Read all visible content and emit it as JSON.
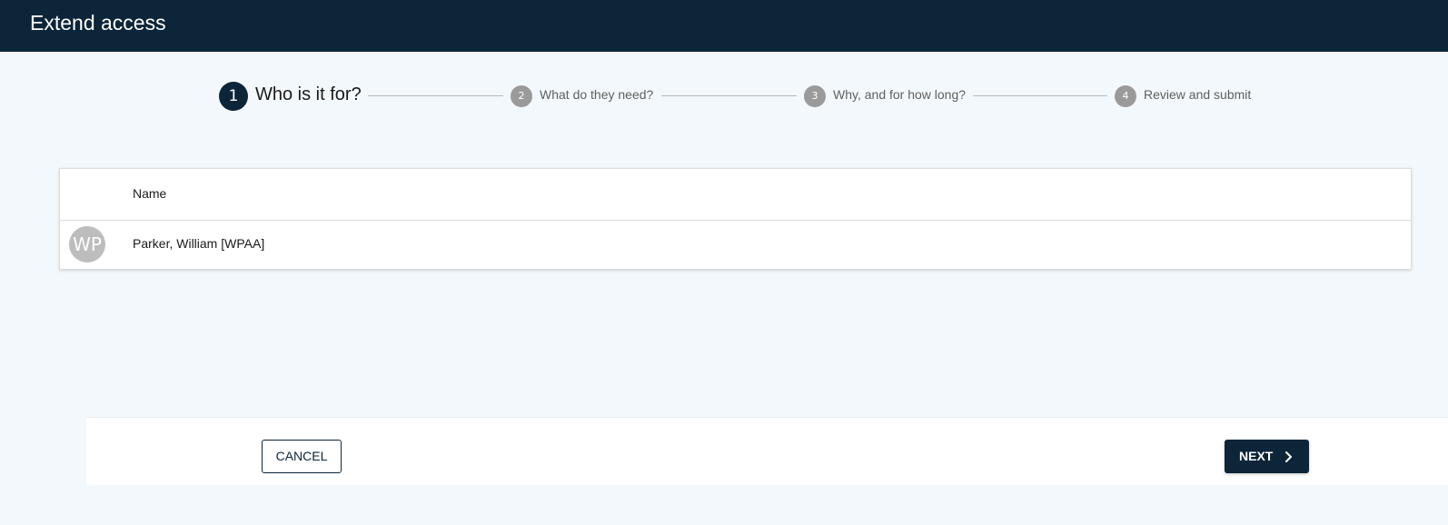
{
  "header": {
    "title": "Extend access"
  },
  "stepper": {
    "steps": [
      {
        "number": "1",
        "label": "Who is it for?",
        "state": "active"
      },
      {
        "number": "2",
        "label": "What do they need?",
        "state": "inactive"
      },
      {
        "number": "3",
        "label": "Why, and for how long?",
        "state": "inactive"
      },
      {
        "number": "4",
        "label": "Review and submit",
        "state": "inactive"
      }
    ]
  },
  "table": {
    "columns": [
      "Name"
    ],
    "rows": [
      {
        "initials": "WP",
        "name": "Parker, William [WPAA]"
      }
    ]
  },
  "footer": {
    "cancel_label": "CANCEL",
    "next_label": "NEXT"
  },
  "colors": {
    "brand_dark": "#0c2538",
    "page_bg": "#f3f8fc",
    "inactive_step": "#9a9a9a",
    "avatar_bg": "#bdbdbd"
  },
  "icons": {
    "next": "chevron-right-icon"
  }
}
